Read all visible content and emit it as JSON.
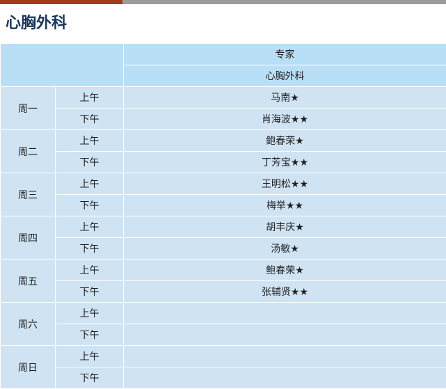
{
  "colors": {
    "accent_left": "#a23b1a",
    "accent_right": "#9c9c9c",
    "header_bg": "#b9dff6",
    "cell_bg": "#cfe3f3",
    "title": "#17365d"
  },
  "title": "心胸外科",
  "header": {
    "row1": "专家",
    "row2": "心胸外科"
  },
  "schedule": [
    {
      "day": "周一",
      "morning_label": "上午",
      "morning": "马南★",
      "afternoon_label": "下午",
      "afternoon": "肖海波★★"
    },
    {
      "day": "周二",
      "morning_label": "上午",
      "morning": "鲍春荣★",
      "afternoon_label": "下午",
      "afternoon": "丁芳宝★★"
    },
    {
      "day": "周三",
      "morning_label": "上午",
      "morning": "王明松★★",
      "afternoon_label": "下午",
      "afternoon": "梅举★★"
    },
    {
      "day": "周四",
      "morning_label": "上午",
      "morning": "胡丰庆★",
      "afternoon_label": "下午",
      "afternoon": "汤敏★"
    },
    {
      "day": "周五",
      "morning_label": "上午",
      "morning": "鲍春荣★",
      "afternoon_label": "下午",
      "afternoon": "张辅贤★★"
    },
    {
      "day": "周六",
      "morning_label": "上午",
      "morning": "",
      "afternoon_label": "下午",
      "afternoon": ""
    },
    {
      "day": "周日",
      "morning_label": "上午",
      "morning": "",
      "afternoon_label": "下午",
      "afternoon": ""
    }
  ]
}
